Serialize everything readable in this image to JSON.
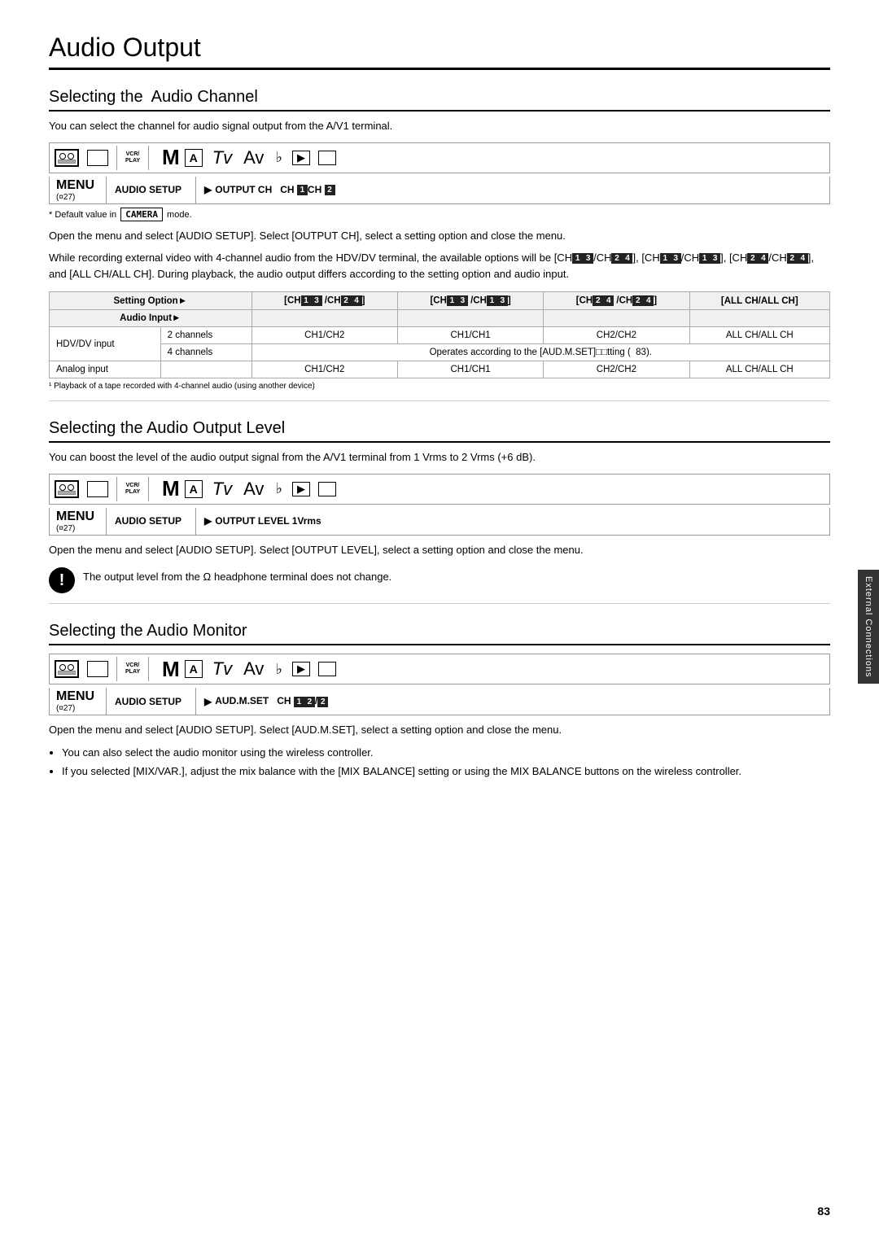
{
  "page": {
    "title": "Audio Output",
    "page_number": "83",
    "sidebar_label": "External Connections"
  },
  "sections": {
    "select_channel": {
      "heading": "Selecting the  Audio Channel",
      "intro": "You can select the channel for audio signal output from the A/V1 terminal.",
      "menu_label": "MENU",
      "menu_sub": "(¤27)",
      "menu_item": "AUDIO SETUP",
      "menu_content": "OUTPUT CH  CH ①CH ②",
      "camera_note": "* Default value in",
      "camera_badge": "CAMERA",
      "camera_note2": "mode.",
      "body1": "Open the menu and select [AUDIO SETUP]. Select [OUTPUT CH], select a setting option and close the menu.",
      "body2": "While recording external video with 4-channel audio from the HDV/DV terminal, the available options will be [CH■/CH■], [CH■/CH■], [CH■/CH■], and [ALL CH/ALL CH]. During playback, the audio output differs according to the setting option and audio input.",
      "table": {
        "col_headers": [
          "Setting Option▶",
          "[CH●● /CH●●]",
          "[CH●● /CH●●]",
          "[CH●● /CH●●]",
          "[ALL CH/ALL CH]"
        ],
        "row1_label": "Audio Input▶",
        "rows": [
          {
            "label": "HDV/DV input",
            "sub": "2 channels",
            "cols": [
              "CH1/CH2",
              "CH1/CH1",
              "CH2/CH2",
              "ALL CH/ALL CH"
            ]
          },
          {
            "label": "",
            "sub": "4 channels",
            "cols": [
              "Operates according to the [AUD.M.SET]□□tting (",
              "",
              "",
              "83)."
            ]
          },
          {
            "label": "Analog input",
            "sub": "",
            "cols": [
              "CH1/CH2",
              "CH1/CH1",
              "CH2/CH2",
              "ALL CH/ALL CH"
            ]
          }
        ],
        "footnote": "¹ Playback of a tape recorded with 4-channel audio (using another device)"
      }
    },
    "select_level": {
      "heading": "Selecting the Audio Output Level",
      "intro": "You can boost the level of the audio output signal from the A/V1 terminal from 1 Vrms to 2 Vrms (+6 dB).",
      "menu_label": "MENU",
      "menu_sub": "(¤27)",
      "menu_item": "AUDIO SETUP",
      "menu_content": "OUTPUT LEVEL  1Vrms",
      "body1": "Open the menu and select [AUDIO SETUP]. Select [OUTPUT LEVEL], select a setting option and close the menu.",
      "warning": "The output level from the Ω headphone terminal does not change."
    },
    "select_monitor": {
      "heading": "Selecting the Audio Monitor",
      "menu_label": "MENU",
      "menu_sub": "(¤27)",
      "menu_item": "AUDIO SETUP",
      "menu_content": "AUD.M.SET  CH ●●/●●",
      "body1": "Open the menu and select [AUDIO SETUP]. Select [AUD.M.SET], select a setting option and close the menu.",
      "bullets": [
        "You can also select the audio monitor using the wireless controller.",
        "If you selected [MIX/VAR.], adjust the mix balance with the [MIX BALANCE] setting or using the MIX BALANCE buttons on the wireless controller."
      ]
    }
  },
  "icons": {
    "tape": "tape-icon",
    "screen": "screen-icon",
    "vcr_play": "vcr-play-icon",
    "M": "M-mode-icon",
    "A_box": "A-box-icon",
    "Tv": "Tv-icon",
    "Av": "Av-icon",
    "bell": "bell-icon",
    "rect1": "rect1-icon",
    "rect2": "rect2-icon",
    "warning": "warning-icon",
    "arrow": "menu-arrow-icon"
  }
}
